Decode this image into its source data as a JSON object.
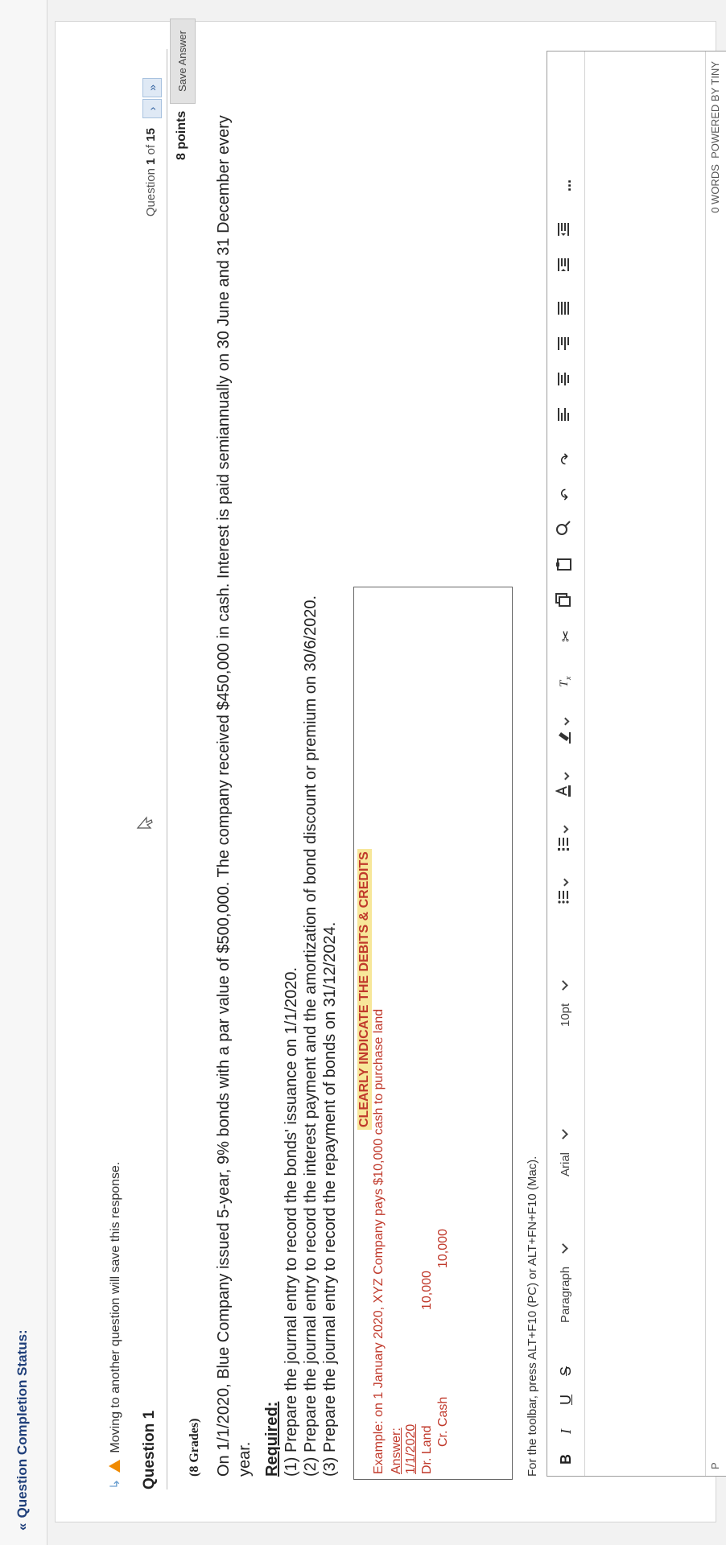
{
  "header": {
    "status_title": "Question Completion Status:"
  },
  "notice": {
    "text": "Moving to another question will save this response."
  },
  "question": {
    "title": "Question 1",
    "counter_prefix": "Question ",
    "counter_current": "1",
    "counter_of": " of ",
    "counter_total": "15",
    "points": "8 points",
    "save_label": "Save Answer",
    "grade": "(8 Grades)",
    "text": "On 1/1/2020, Blue Company issued 5-year, 9% bonds with a par value of $500,000. The company received $450,000 in cash. Interest is paid semiannually on 30 June and 31 December every year.",
    "required_title": "Required:",
    "required": [
      "(1) Prepare the journal entry to record the bonds' issuance on 1/1/2020.",
      "(2) Prepare the journal entry to record the interest payment and the amortization of bond discount or premium on 30/6/2020.",
      "(3) Prepare the journal entry to record the repayment of bonds on 31/12/2024."
    ]
  },
  "example": {
    "note": "CLEARLY INDICATE THE DEBITS & CREDITS",
    "line": "Example: on 1 January 2020, XYZ Company pays $10,000 cash to purchase land",
    "answer_label": "Answer:",
    "date": "1/1/2020",
    "debit": "Dr. Land",
    "debit_amount": "10,000",
    "credit": "Cr. Cash",
    "credit_amount": "10,000"
  },
  "editor": {
    "hint": "For the toolbar, press ALT+F10 (PC) or ALT+FN+F10 (Mac).",
    "bold": "B",
    "italic": "I",
    "underline": "U",
    "strike": "S",
    "block_format": "Paragraph",
    "font_family": "Arial",
    "font_size": "10pt",
    "more": "...",
    "path": "P",
    "word_count": "0 WORDS",
    "powered_by": "POWERED BY TINY"
  },
  "colors": {
    "accent": "#1f3f7a",
    "warning": "#f08a00",
    "highlight": "#f7e79a",
    "example_text": "#c0392b"
  }
}
